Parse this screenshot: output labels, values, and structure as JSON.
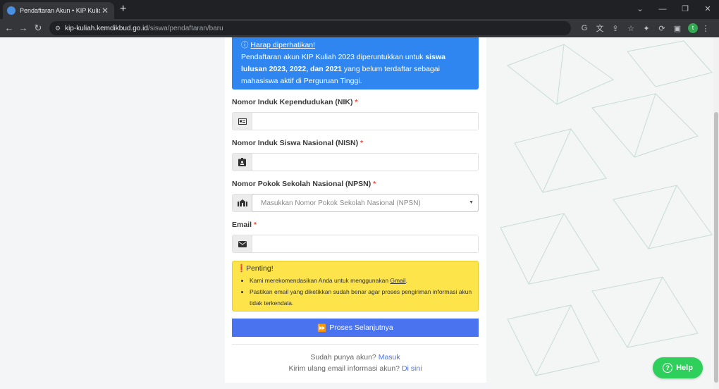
{
  "browser": {
    "tab_title": "Pendaftaran Akun • KIP Kuliah",
    "tab_close": "✕",
    "new_tab": "+",
    "url_host": "kip-kuliah.kemdikbud.go.id",
    "url_path": "/siswa/pendaftaran/baru",
    "profile_initial": "t"
  },
  "notice": {
    "title": "Harap diperhatikan!",
    "text_1": "Pendaftaran akun KIP Kuliah 2023 diperuntukkan untuk ",
    "bold_1": "siswa lulusan 2023, 2022, dan 2021",
    "text_2": " yang belum terdaftar sebagai mahasiswa aktif di Perguruan Tinggi."
  },
  "form": {
    "nik_label": "Nomor Induk Kependudukan (NIK)",
    "nisn_label": "Nomor Induk Siswa Nasional (NISN)",
    "npsn_label": "Nomor Pokok Sekolah Nasional (NPSN)",
    "npsn_placeholder": "Masukkan Nomor Pokok Sekolah Nasional (NPSN)",
    "email_label": "Email",
    "required_mark": "*"
  },
  "important": {
    "title": "Penting!",
    "item_1_pre": "Kami merekomendasikan Anda untuk menggunakan ",
    "item_1_link": "Gmail",
    "item_1_post": ".",
    "item_2": "Pastikan email yang diketikkan sudah benar agar proses pengiriman informasi akun tidak terkendala."
  },
  "actions": {
    "next_button": "Proses Selanjutnya",
    "login_prompt": "Sudah punya akun? ",
    "login_link": "Masuk",
    "resend_prompt": "Kirim ulang email informasi akun? ",
    "resend_link": "Di sini",
    "help_button": "Help"
  }
}
